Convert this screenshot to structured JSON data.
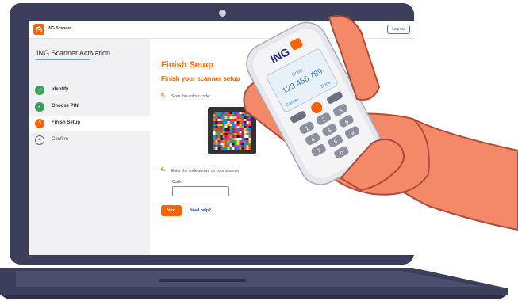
{
  "topbar": {
    "app_name": "ING Scanner",
    "logout_label": "Log out"
  },
  "sidebar": {
    "title": "ING Scanner Activation",
    "steps": [
      {
        "label": "Identify",
        "status": "done",
        "marker": "✓"
      },
      {
        "label": "Choose PIN",
        "status": "done",
        "marker": "✓"
      },
      {
        "label": "Finish Setup",
        "status": "current",
        "marker": "3"
      },
      {
        "label": "Confirm",
        "status": "todo",
        "marker": "4"
      }
    ]
  },
  "main": {
    "heading": "Finish Setup",
    "subheading": "Finish your scanner setup",
    "step5_num": "5.",
    "step5_text": "Scan this colour code:",
    "step6_num": "6.",
    "step6_text": "Enter the code shown on your scanner:",
    "code_label": "Code",
    "code_value": "",
    "next_label": "Next",
    "help_label": "Need help?"
  },
  "device": {
    "brand": "ING",
    "screen_label": "Code:",
    "screen_code": "123 456 789",
    "cancel_label": "Cancel",
    "done_label": "Done",
    "keys": [
      "1",
      "2",
      "3",
      "4",
      "5",
      "6",
      "7",
      "8",
      "9",
      "0"
    ]
  },
  "colors": {
    "accent": "#ff6200",
    "success": "#3aa05a",
    "laptop_body": "#3b3f5c",
    "link": "#2a3ca8",
    "hand": "#f4896a"
  }
}
